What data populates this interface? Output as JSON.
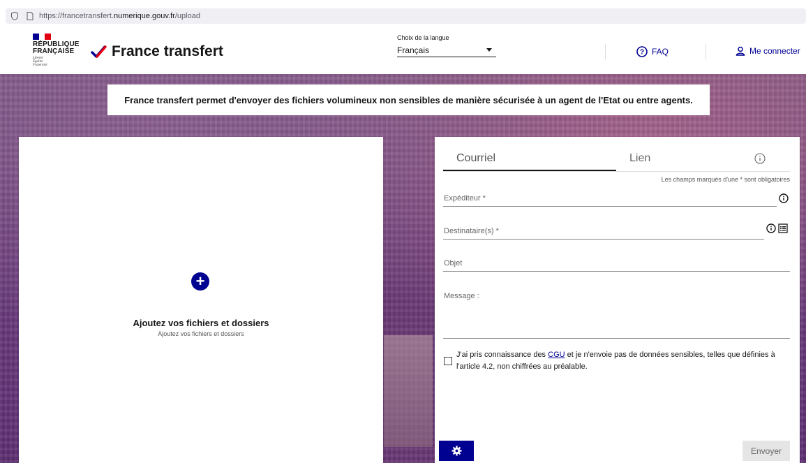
{
  "browser": {
    "url_prefix": "https://francetransfert.",
    "url_host": "numerique.gouv.fr",
    "url_path": "/upload"
  },
  "header": {
    "gov_name_line1": "RÉPUBLIQUE",
    "gov_name_line2": "FRANÇAISE",
    "gov_motto_1": "Liberté",
    "gov_motto_2": "Égalité",
    "gov_motto_3": "Fraternité",
    "brand": "France transfert",
    "lang_label": "Choix de la langue",
    "lang_value": "Français",
    "faq": "FAQ",
    "login": "Me connecter"
  },
  "banner": "France transfert permet d'envoyer des fichiers volumineux non sensibles de manière sécurisée à un agent de l'Etat ou entre agents.",
  "upload": {
    "title": "Ajoutez vos fichiers et dossiers",
    "subtitle": "Ajoutez vos fichiers et dossiers"
  },
  "form": {
    "tabs": [
      "Courriel",
      "Lien"
    ],
    "required_note": "Les champs marqués d'une * sont obligatoires",
    "sender_label": "Expéditeur *",
    "recipients_label": "Destinataire(s) *",
    "subject_label": "Objet",
    "message_label": "Message :",
    "cgu_before": "J'ai pris connaissance des ",
    "cgu_link": "CGU",
    "cgu_after": " et je n'envoie pas de données sensibles, telles que définies à l'article 4.2, non chiffrées au préalable.",
    "send_button": "Envoyer"
  },
  "colors": {
    "primary": "#000091",
    "flag_blue": "#000091",
    "flag_red": "#e1000f"
  }
}
